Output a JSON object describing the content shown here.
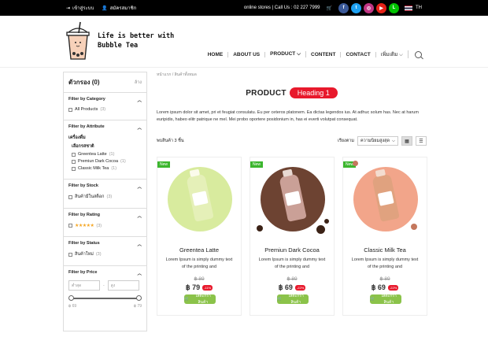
{
  "topbar": {
    "login": "เข้าสู่ระบบ",
    "register": "สมัครสมาชิก",
    "stores": "online stores | Call Us : 02 227 7999",
    "lang": "TH",
    "social": [
      {
        "icon": "facebook-icon",
        "glyph": "f",
        "color": "#3b5998"
      },
      {
        "icon": "twitter-icon",
        "glyph": "t",
        "color": "#1da1f2"
      },
      {
        "icon": "instagram-icon",
        "glyph": "◎",
        "color": "#c13584"
      },
      {
        "icon": "youtube-icon",
        "glyph": "▶",
        "color": "#e62117"
      },
      {
        "icon": "line-icon",
        "glyph": "L",
        "color": "#00c300"
      }
    ]
  },
  "logo": {
    "line1": "Life is better with",
    "line2": "Bubble Tea"
  },
  "nav": {
    "items": [
      "HOME",
      "ABOUT US",
      "PRODUCT ⌵",
      "CONTENT",
      "CONTACT",
      "เพิ่มเติม ⌵"
    ]
  },
  "sidebar": {
    "title": "ตัวกรอง (0)",
    "clear": "ล้าง",
    "category": {
      "title": "Filter by Category",
      "options": [
        {
          "label": "All Products",
          "count": "(3)"
        }
      ]
    },
    "attribute": {
      "title": "Filter by Attribute",
      "group": "เครื่องดื่ม",
      "sub": "เลือกรสชาติ",
      "options": [
        {
          "label": "Greentea Latte",
          "count": "(1)"
        },
        {
          "label": "Premiun Dark Cocoa",
          "count": "(1)"
        },
        {
          "label": "Classic Milk Tea",
          "count": "(1)"
        }
      ]
    },
    "stock": {
      "title": "Filter by Stock",
      "options": [
        {
          "label": "สินค้ามีในสต็อก",
          "count": "(3)"
        }
      ]
    },
    "rating": {
      "title": "Filter by Rating",
      "stars": "★★★★★",
      "count": "(3)"
    },
    "status": {
      "title": "Filter by Status",
      "options": [
        {
          "label": "สินค้าใหม่",
          "count": "(3)"
        }
      ]
    },
    "price": {
      "title": "Filter by Price",
      "min_placeholder": "ต่ำสุด",
      "max_placeholder": "สูง",
      "min": "฿ 69",
      "max": "฿ 79"
    }
  },
  "main": {
    "breadcrumb": "หน้าแรก  /  สินค้าทั้งหมด",
    "heading_prefix": "PRODUCT",
    "heading_badge": "Heading 1",
    "description": "Lorem ipsum dolor sit amet, pri et feugiat consulatu. Eu per ceteros platonem. Ea dictas legendos ius. At adhuc solum has. Nec at harum euripidis, habeo elitr patrique ne mel. Mei probo oportere posidonium in, has ei everti volutpat consequat.",
    "count": "พบสินค้า 3 ชิ้น",
    "sort_label": "เรียงตาม",
    "sort_value": "ความนิยมสูงสุด"
  },
  "products": [
    {
      "new": "New",
      "name": "Greentea Latte",
      "desc": "Lorem Ipsum is simply dummy text of the printing and",
      "old": "฿ 89",
      "price": "฿ 79",
      "discount": "-11%",
      "cart": "ใส่ตะกร้าสินค้า",
      "bg": "#d8eb9e",
      "bottle": "#e5f0b8",
      "cap": "#fbfbeb"
    },
    {
      "new": "New",
      "name": "Premiun Dark Cocoa",
      "desc": "Lorem Ipsum is simply dummy text of the printing and",
      "old": "฿ 89",
      "price": "฿ 69",
      "discount": "-22%",
      "cart": "ใส่ตะกร้าสินค้า",
      "bg": "#6d4332",
      "bottle": "#caa097",
      "cap": "#e8d9d2"
    },
    {
      "new": "New",
      "name": "Classic Milk Tea",
      "desc": "Lorem Ipsum is simply dummy text of the printing and",
      "old": "฿ 89",
      "price": "฿ 69",
      "discount": "-22%",
      "cart": "ใส่ตะกร้าสินค้า",
      "bg": "#f2a58a",
      "bottle": "#e0a27f",
      "cap": "#f3ddd0"
    }
  ]
}
